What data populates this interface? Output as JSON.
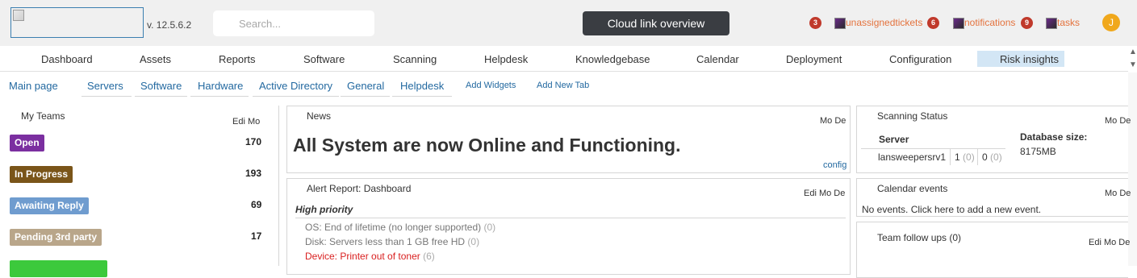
{
  "header": {
    "version": "v. 12.5.6.2",
    "search_placeholder": "Search...",
    "cloud_button": "Cloud link overview",
    "badges": {
      "first": "3",
      "unassigned": "6",
      "notifications": "9"
    },
    "links": {
      "unassigned": "unassignedtickets",
      "notifications": "notifications",
      "tasks": "tasks"
    },
    "avatar_initial": "J",
    "colors": {
      "badge": "#c0392b",
      "link": "#e4733e",
      "avatar": "#f0a81c",
      "cloud_button": "#3a3d42"
    }
  },
  "nav": {
    "items": [
      "Dashboard",
      "Assets",
      "Reports",
      "Software",
      "Scanning",
      "Helpdesk",
      "Knowledgebase",
      "Calendar",
      "Deployment",
      "Configuration",
      "Risk insights"
    ],
    "active": "Risk insights"
  },
  "tabs": {
    "items": [
      "Main page",
      "Servers",
      "Software",
      "Hardware",
      "Active Directory",
      "General",
      "Helpdesk"
    ],
    "add_widgets": "Add Widgets",
    "add_tab": "Add New Tab"
  },
  "panel_tools": "Edi Mo De",
  "panel_tools_short": "Mo De",
  "my_teams": {
    "title": "My Teams",
    "rows": [
      {
        "label": "Open",
        "count": "170",
        "color": "#7b2fa0"
      },
      {
        "label": "In Progress",
        "count": "193",
        "color": "#7a5519"
      },
      {
        "label": "Awaiting Reply",
        "count": "69",
        "color": "#6f9ccf"
      },
      {
        "label": "Pending 3rd party",
        "count": "17",
        "color": "#b9a68a"
      },
      {
        "label": "",
        "count": "",
        "color": "#3cc93c"
      }
    ]
  },
  "news": {
    "title": "News",
    "headline": "All System are now Online and Functioning.",
    "config_link": "config"
  },
  "alert_report": {
    "title": "Alert Report: Dashboard",
    "heading": "High priority",
    "items": [
      {
        "text": "OS: End of lifetime (no longer supported)",
        "count": "(0)"
      },
      {
        "text": "Disk: Servers less than 1 GB free HD",
        "count": "(0)"
      },
      {
        "text": "Device: Printer out of toner",
        "count": "(6)"
      }
    ]
  },
  "scanning_status": {
    "title": "Scanning Status",
    "server_header": "Server",
    "server_name": "lansweepersrv1",
    "val1": "1",
    "val1_sub": "(0)",
    "val2": "0",
    "val2_sub": "(0)",
    "db_label": "Database size:",
    "db_value": "8175MB"
  },
  "calendar_events": {
    "title": "Calendar events",
    "empty_text": "No events. Click here to add a new event."
  },
  "team_followups": {
    "title": "Team follow ups (0)"
  }
}
